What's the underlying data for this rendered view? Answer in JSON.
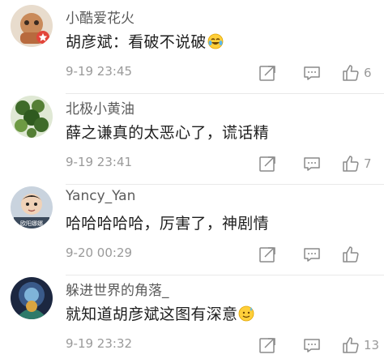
{
  "comments": [
    {
      "username": "小酷爱花火",
      "text": "胡彦斌：看破不说破",
      "emoji": "laughing-tears-emoji",
      "time": "9-19 23:45",
      "likes": "6"
    },
    {
      "username": "北极小黄油",
      "text": "薛之谦真的太恶心了，谎话精",
      "emoji": "",
      "time": "9-19 23:41",
      "likes": "7"
    },
    {
      "username": "Yancy_Yan",
      "text": "哈哈哈哈哈，厉害了，神剧情",
      "emoji": "",
      "time": "9-20 00:29",
      "likes": ""
    },
    {
      "username": "躲进世界的角落_",
      "text": "就知道胡彦斌这图有深意",
      "emoji": "sweat-smile-emoji",
      "time": "9-19 23:32",
      "likes": "13"
    }
  ],
  "icons": {
    "repost": "edit-share-icon",
    "reply": "comment-bubble-icon",
    "like": "thumbs-up-icon"
  },
  "colors": {
    "text": "#1f1f1f",
    "meta": "#9a9a9a",
    "username": "#5b5b5b"
  }
}
